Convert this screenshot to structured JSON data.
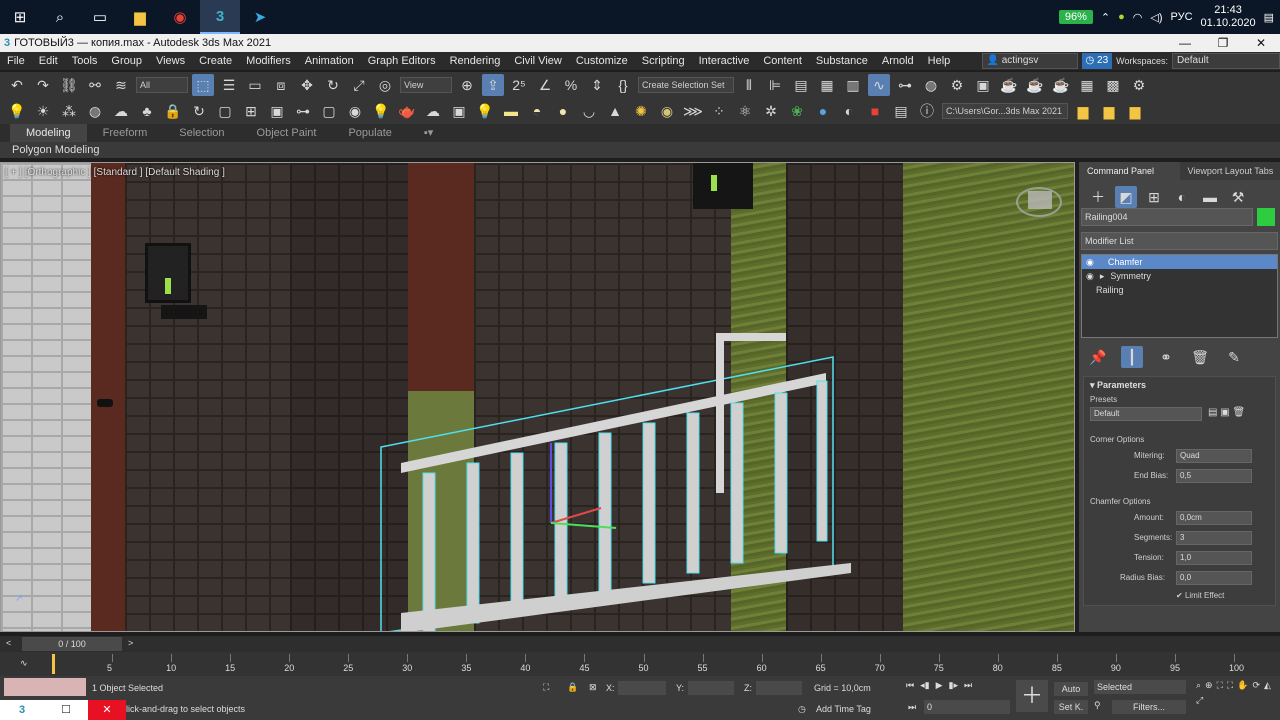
{
  "taskbar": {
    "battery": "96%",
    "lang": "РУС",
    "time": "21:43",
    "date": "01.10.2020"
  },
  "window": {
    "title": "ГОТОВЫЙ3 — копия.max - Autodesk 3ds Max 2021"
  },
  "menu": {
    "items": [
      "File",
      "Edit",
      "Tools",
      "Group",
      "Views",
      "Create",
      "Modifiers",
      "Animation",
      "Graph Editors",
      "Rendering",
      "Civil View",
      "Customize",
      "Scripting",
      "Interactive",
      "Content",
      "Substance",
      "Arnold",
      "Help"
    ],
    "user": "actingsv",
    "notifications": "23",
    "workspaces_label": "Workspaces:",
    "workspace": "Default"
  },
  "toolbar": {
    "filter": "All",
    "ref_coord": "View",
    "selection_set": "Create Selection Set",
    "path": "C:\\Users\\Gor...3ds Max 2021"
  },
  "ribbon": {
    "tabs": [
      "Modeling",
      "Freeform",
      "Selection",
      "Object Paint",
      "Populate"
    ],
    "subtitle": "Polygon Modeling"
  },
  "viewport": {
    "label": "[ + ] [Orthographic ] [Standard ] [Default Shading ]"
  },
  "command_panel": {
    "tabs": [
      "Command Panel",
      "Viewport Layout Tabs"
    ],
    "object_name": "Railing004",
    "object_color": "#2ecc40",
    "modifier_list": "Modifier List",
    "stack": [
      "Chamfer",
      "Symmetry",
      "Railing"
    ],
    "parameters": "Parameters",
    "presets_label": "Presets",
    "preset": "Default",
    "corner_options": "Corner Options",
    "mitering_label": "Mitering:",
    "mitering": "Quad",
    "end_bias_label": "End Bias:",
    "end_bias": "0,5",
    "chamfer_options": "Chamfer Options",
    "amount_label": "Amount:",
    "amount": "0,0cm",
    "segments_label": "Segments:",
    "segments": "3",
    "tension_label": "Tension:",
    "tension": "1,0",
    "radius_bias_label": "Radius Bias:",
    "radius_bias": "0,0",
    "limit_effect": "Limit Effect"
  },
  "timeline": {
    "frame": "0 / 100",
    "ticks": [
      "5",
      "10",
      "15",
      "20",
      "25",
      "30",
      "35",
      "40",
      "45",
      "50",
      "55",
      "60",
      "65",
      "70",
      "75",
      "80",
      "85",
      "90",
      "95",
      "100"
    ]
  },
  "status": {
    "selected": "1 Object Selected",
    "prompt": "lick-and-drag to select objects",
    "x_label": "X:",
    "y_label": "Y:",
    "z_label": "Z:",
    "grid": "Grid = 10,0cm",
    "add_time_tag": "Add Time Tag",
    "auto": "Auto",
    "selected_dd": "Selected",
    "set_key": "Set K.",
    "filters": "Filters...",
    "frame_field": "0"
  }
}
